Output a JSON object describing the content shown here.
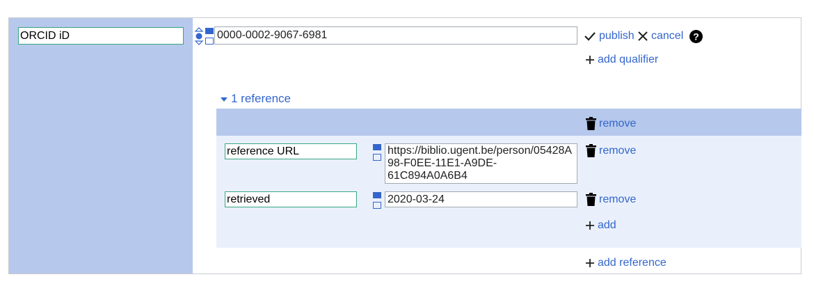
{
  "statement": {
    "property_value": "ORCID iD",
    "main_value": "0000-0002-9067-6981",
    "publish_label": "publish",
    "cancel_label": "cancel",
    "add_qualifier_label": "add qualifier"
  },
  "references": {
    "toggle_label": "1 reference",
    "remove_label": "remove",
    "snaks": [
      {
        "property": "reference URL",
        "value": "https://biblio.ugent.be/person/05428A98-F0EE-11E1-A9DE-61C894A0A6B4",
        "remove_label": "remove"
      },
      {
        "property": "retrieved",
        "value": "2020-03-24",
        "remove_label": "remove"
      }
    ],
    "add_label": "add",
    "add_reference_label": "add reference"
  },
  "colors": {
    "link": "#3366cc",
    "panel": "#b6c8ec",
    "panel_light": "#eaf0fb",
    "focus_border": "#36a680"
  },
  "icons": [
    "rank-normal-icon",
    "snak-type-icon",
    "checkmark-icon",
    "close-icon",
    "help-icon",
    "trash-icon",
    "plus-icon",
    "triangle-down-icon"
  ]
}
